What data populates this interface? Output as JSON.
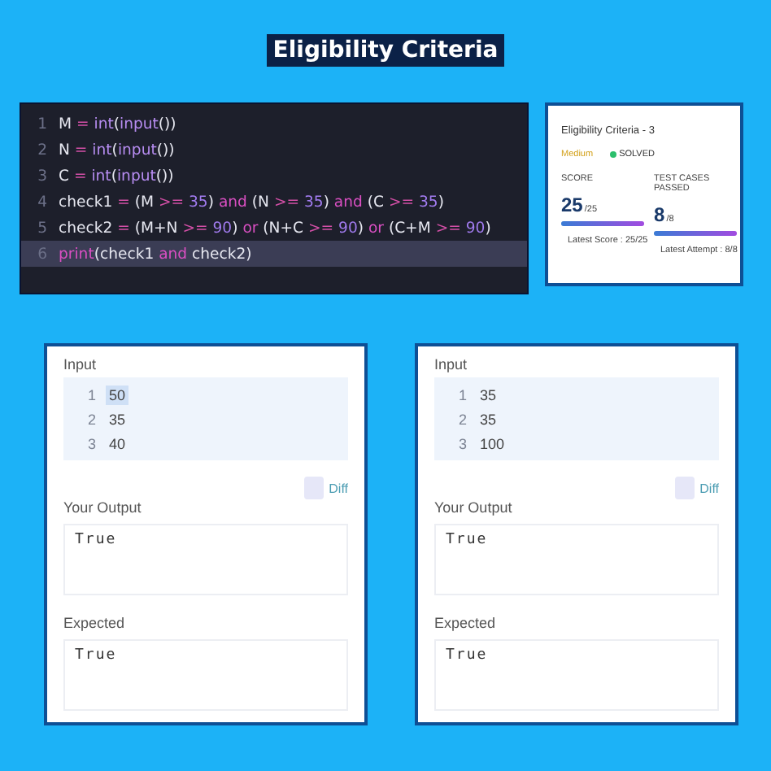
{
  "heading": "Eligibility Criteria",
  "code": {
    "lines": [
      {
        "number": "1",
        "selected": false,
        "tokens": [
          {
            "text": "M",
            "kind": "name"
          },
          {
            "text": " = ",
            "kind": "op"
          },
          {
            "text": "int",
            "kind": "fn"
          },
          {
            "text": "(",
            "kind": "punct"
          },
          {
            "text": "input",
            "kind": "fn"
          },
          {
            "text": "())",
            "kind": "punct"
          }
        ]
      },
      {
        "number": "2",
        "selected": false,
        "tokens": [
          {
            "text": "N",
            "kind": "name"
          },
          {
            "text": " = ",
            "kind": "op"
          },
          {
            "text": "int",
            "kind": "fn"
          },
          {
            "text": "(",
            "kind": "punct"
          },
          {
            "text": "input",
            "kind": "fn"
          },
          {
            "text": "())",
            "kind": "punct"
          }
        ]
      },
      {
        "number": "3",
        "selected": false,
        "tokens": [
          {
            "text": "C",
            "kind": "name"
          },
          {
            "text": " = ",
            "kind": "op"
          },
          {
            "text": "int",
            "kind": "fn"
          },
          {
            "text": "(",
            "kind": "punct"
          },
          {
            "text": "input",
            "kind": "fn"
          },
          {
            "text": "())",
            "kind": "punct"
          }
        ]
      },
      {
        "number": "4",
        "selected": false,
        "tokens": [
          {
            "text": "check1",
            "kind": "name"
          },
          {
            "text": " = ",
            "kind": "op"
          },
          {
            "text": "(M ",
            "kind": "name"
          },
          {
            "text": ">=",
            "kind": "op"
          },
          {
            "text": " 35",
            "kind": "num"
          },
          {
            "text": ") ",
            "kind": "name"
          },
          {
            "text": "and",
            "kind": "kw"
          },
          {
            "text": " (N ",
            "kind": "name"
          },
          {
            "text": ">=",
            "kind": "op"
          },
          {
            "text": " 35",
            "kind": "num"
          },
          {
            "text": ") ",
            "kind": "name"
          },
          {
            "text": "and",
            "kind": "kw"
          },
          {
            "text": " (C ",
            "kind": "name"
          },
          {
            "text": ">=",
            "kind": "op"
          },
          {
            "text": " 35",
            "kind": "num"
          },
          {
            "text": ")",
            "kind": "name"
          }
        ]
      },
      {
        "number": "5",
        "selected": false,
        "tokens": [
          {
            "text": "check2",
            "kind": "name"
          },
          {
            "text": " = ",
            "kind": "op"
          },
          {
            "text": "(M+N ",
            "kind": "name"
          },
          {
            "text": ">=",
            "kind": "op"
          },
          {
            "text": " 90",
            "kind": "num"
          },
          {
            "text": ") ",
            "kind": "name"
          },
          {
            "text": "or",
            "kind": "kw"
          },
          {
            "text": " (N+C ",
            "kind": "name"
          },
          {
            "text": ">=",
            "kind": "op"
          },
          {
            "text": " 90",
            "kind": "num"
          },
          {
            "text": ") ",
            "kind": "name"
          },
          {
            "text": "or",
            "kind": "kw"
          },
          {
            "text": " (C+M ",
            "kind": "name"
          },
          {
            "text": ">=",
            "kind": "op"
          },
          {
            "text": " 90",
            "kind": "num"
          },
          {
            "text": ")",
            "kind": "name"
          }
        ]
      },
      {
        "number": "6",
        "selected": true,
        "tokens": [
          {
            "text": "print",
            "kind": "kw"
          },
          {
            "text": "(check1 ",
            "kind": "name"
          },
          {
            "text": "and",
            "kind": "kw"
          },
          {
            "text": " check2)",
            "kind": "name"
          }
        ]
      }
    ]
  },
  "summary": {
    "title": "Eligibility Criteria - 3",
    "difficulty": "Medium",
    "status": "SOLVED",
    "stats": [
      {
        "label": "SCORE",
        "value": "25",
        "total": "/25",
        "level": 1,
        "note": "Latest Score : 25/25"
      },
      {
        "label": "TEST CASES PASSED",
        "value": "8",
        "total": "/8",
        "level": 1,
        "note": "Latest Attempt : 8/8"
      }
    ]
  },
  "test_cases": [
    {
      "input_label": "Input",
      "input": [
        {
          "number": "1",
          "value": "50",
          "selected": true
        },
        {
          "number": "2",
          "value": "35",
          "selected": false
        },
        {
          "number": "3",
          "value": "40",
          "selected": false
        }
      ],
      "diff": {
        "label": "Diff",
        "checked": false
      },
      "output_label": "Your Output",
      "output": "True",
      "expected_label": "Expected",
      "expected": "True"
    },
    {
      "input_label": "Input",
      "input": [
        {
          "number": "1",
          "value": "35",
          "selected": false
        },
        {
          "number": "2",
          "value": "35",
          "selected": false
        },
        {
          "number": "3",
          "value": "100",
          "selected": false
        }
      ],
      "diff": {
        "label": "Diff",
        "checked": false
      },
      "output_label": "Your Output",
      "output": "True",
      "expected_label": "Expected",
      "expected": "True"
    }
  ]
}
